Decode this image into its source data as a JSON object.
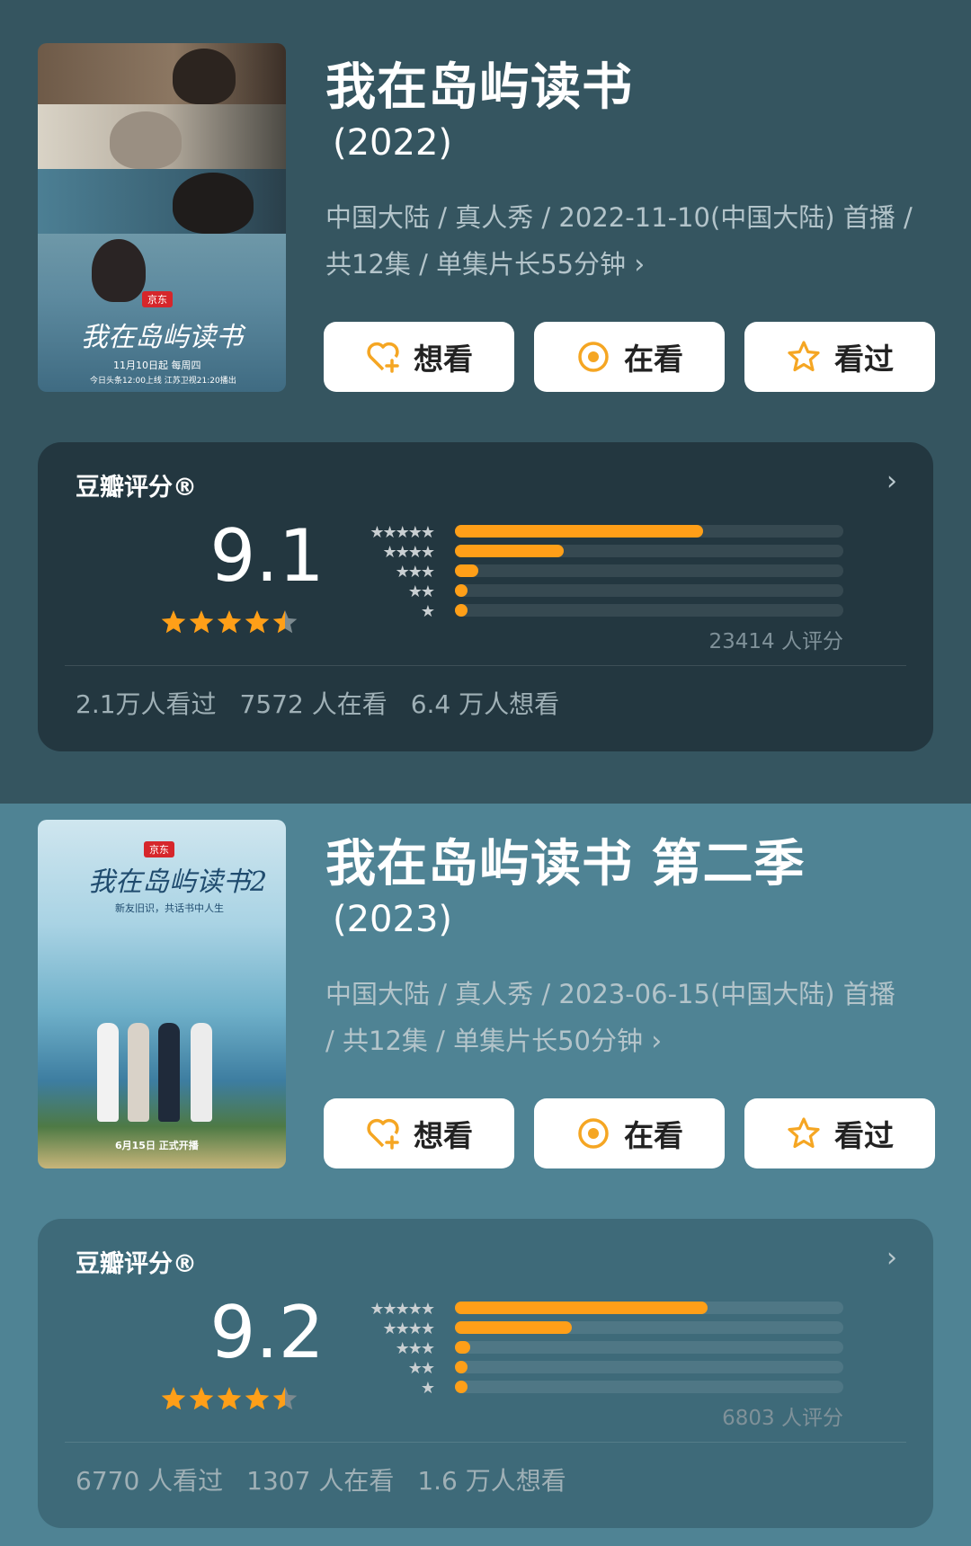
{
  "shows": [
    {
      "title": "我在岛屿读书",
      "year": "(2022)",
      "meta": "中国大陆 / 真人秀 / 2022-11-10(中国大陆) 首播 / 共12集 / 单集片长55分钟",
      "meta_chevron": "›",
      "poster": {
        "badge": "京东",
        "title": "我在岛屿读书",
        "sub": "11月10日起 每周四",
        "sub2": "今日头条12:00上线 江苏卫视21:20播出"
      },
      "buttons": [
        {
          "label": "想看",
          "icon": "heart-plus-icon"
        },
        {
          "label": "在看",
          "icon": "target-circle-icon"
        },
        {
          "label": "看过",
          "icon": "star-outline-icon"
        }
      ],
      "rating": {
        "label": "豆瓣评分®",
        "chevron": "›",
        "score": "9.1",
        "stars": 4.5,
        "distribution": [
          {
            "stars": "★★★★★",
            "value": 0.64
          },
          {
            "stars": "★★★★",
            "value": 0.28
          },
          {
            "stars": "★★★",
            "value": 0.06
          },
          {
            "stars": "★★",
            "value": 0.02
          },
          {
            "stars": "★",
            "value": 0.02
          }
        ],
        "count_text": "23414 人评分",
        "stats": [
          "2.1万人看过",
          "7572 人在看",
          "6.4 万人想看"
        ]
      }
    },
    {
      "title": "我在岛屿读书 第二季",
      "year": "(2023)",
      "meta": "中国大陆 / 真人秀 / 2023-06-15(中国大陆) 首播 / 共12集 / 单集片长50分钟",
      "meta_chevron": "›",
      "poster": {
        "badge": "京东",
        "title": "我在岛屿读书2",
        "sub": "新友旧识，共话书中人生",
        "sub2": "6月15日 正式开播"
      },
      "buttons": [
        {
          "label": "想看",
          "icon": "heart-plus-icon"
        },
        {
          "label": "在看",
          "icon": "target-circle-icon"
        },
        {
          "label": "看过",
          "icon": "star-outline-icon"
        }
      ],
      "rating": {
        "label": "豆瓣评分®",
        "chevron": "›",
        "score": "9.2",
        "stars": 4.5,
        "distribution": [
          {
            "stars": "★★★★★",
            "value": 0.65
          },
          {
            "stars": "★★★★",
            "value": 0.3
          },
          {
            "stars": "★★★",
            "value": 0.04
          },
          {
            "stars": "★★",
            "value": 0.03
          },
          {
            "stars": "★",
            "value": 0.02
          }
        ],
        "count_text": "6803 人评分",
        "stats": [
          "6770 人看过",
          "1307 人在看",
          "1.6 万人想看"
        ]
      }
    }
  ],
  "colors": {
    "accent": "#ff9f18",
    "star": "#ff9f18",
    "button_icon": "#f5a623"
  }
}
